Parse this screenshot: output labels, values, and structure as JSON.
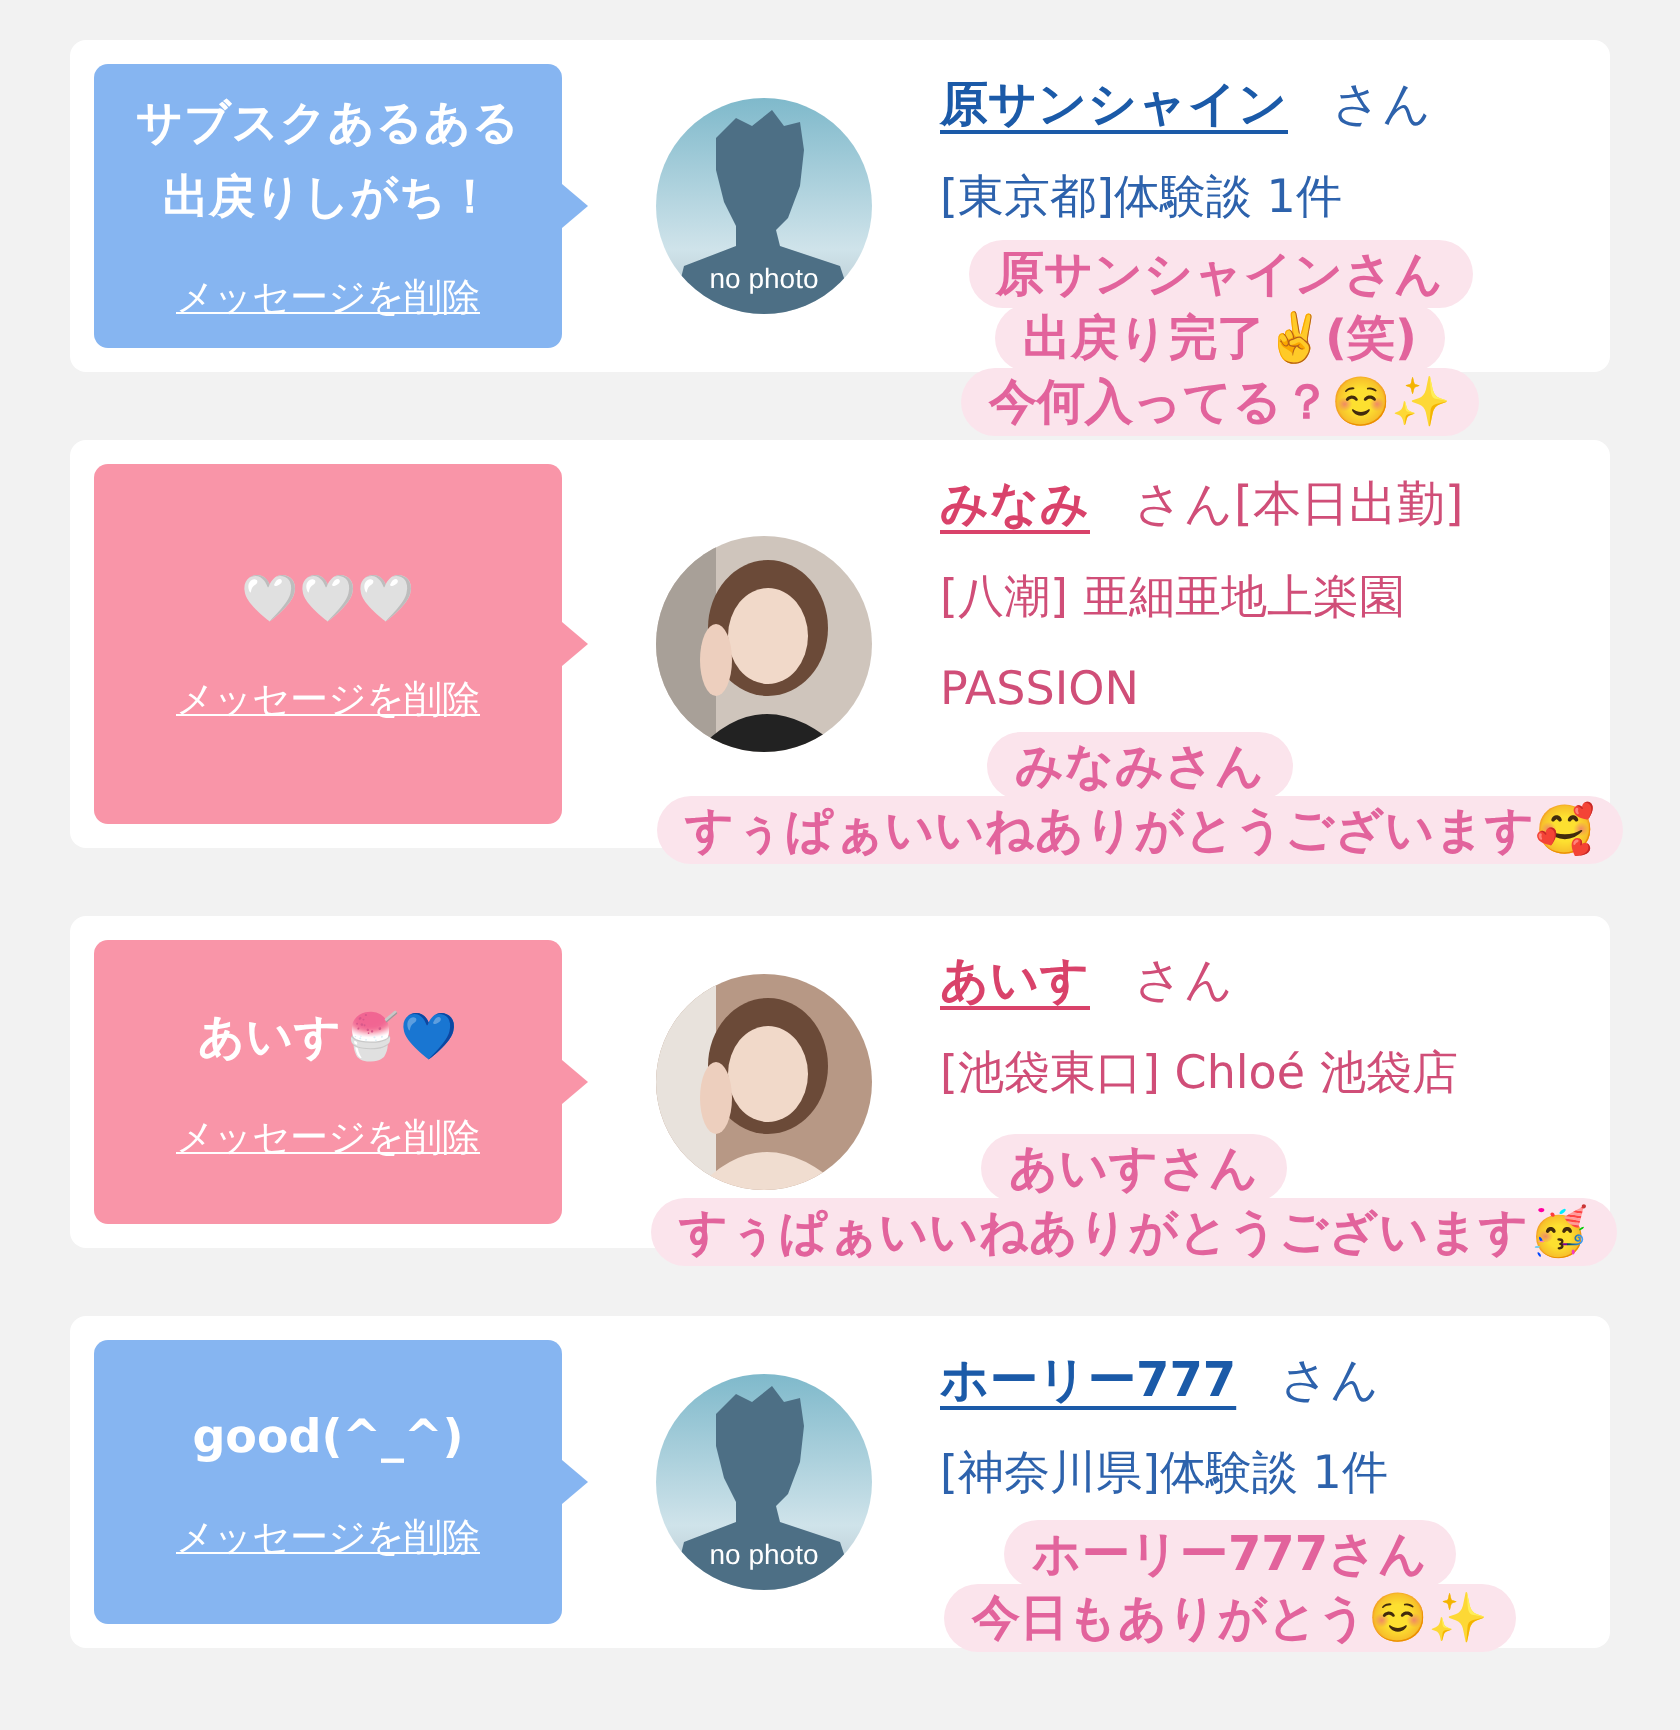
{
  "messages": [
    {
      "kind": "customer",
      "message_lines": [
        "サブスクあるある",
        "出戻りしがち！"
      ],
      "delete_link": "メッセージを削除",
      "avatar": {
        "kind": "placeholder",
        "label": "no photo"
      },
      "name": "原サンシャイン",
      "honorific": "さん",
      "details": [
        "[東京都]体験談 1件"
      ],
      "caption": [
        "原サンシャインさん",
        "出戻り完了✌️(笑)",
        "今何入ってる？☺️✨"
      ]
    },
    {
      "kind": "cast",
      "message_lines": [
        "🤍🤍🤍"
      ],
      "delete_link": "メッセージを削除",
      "avatar": {
        "kind": "picture"
      },
      "name": "みなみ",
      "honorific": "さん",
      "tag": "[本日出勤]",
      "details": [
        "[八潮] 亜細亜地上楽園",
        "PASSION"
      ],
      "caption": [
        "みなみさん",
        "すぅぱぁいいねありがとうございます🥰"
      ]
    },
    {
      "kind": "cast",
      "message_lines": [
        "あいす🍧💙"
      ],
      "delete_link": "メッセージを削除",
      "avatar": {
        "kind": "picture"
      },
      "name": "あいす",
      "honorific": "さん",
      "details": [
        "[池袋東口] Chloé 池袋店"
      ],
      "caption": [
        "あいすさん",
        "すぅぱぁいいねありがとうございます🥳"
      ]
    },
    {
      "kind": "customer",
      "message_lines": [
        "good(^_^)"
      ],
      "delete_link": "メッセージを削除",
      "avatar": {
        "kind": "placeholder",
        "label": "no photo"
      },
      "name": "ホーリー777",
      "honorific": "さん",
      "details": [
        "[神奈川県]体験談 1件"
      ],
      "caption": [
        "ホーリー777さん",
        "今日もありがとう☺️✨"
      ]
    }
  ]
}
